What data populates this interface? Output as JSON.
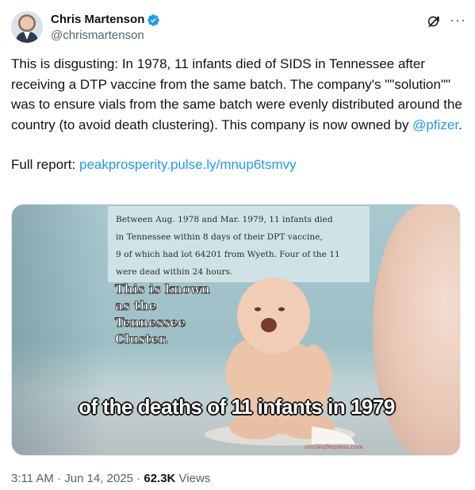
{
  "author": {
    "display_name": "Chris Martenson",
    "handle": "@chrismartenson",
    "verified": true,
    "verified_color": "#1d9bf0"
  },
  "header_icons": [
    "grok-icon",
    "more-icon"
  ],
  "tweet": {
    "text_part1": "This is disgusting: In 1978, 11 infants died of SIDS in Tennessee after receiving a DTP vaccine from the same batch.  The company's \"\"solution\"\" was to ensure vials from the same batch were evenly distributed around the country (to avoid death clustering).  This company is now owned by ",
    "mention": "@pfizer",
    "text_part1_end": ".",
    "full_report_label": "Full report: ",
    "full_report_link": "peakprosperity.pulse.ly/mnup6tsmvy"
  },
  "media": {
    "note_lines": [
      "Between Aug. 1978 and Mar. 1979, 11 infants died",
      "in Tennessee within 8 days of their DPT vaccine,",
      "9 of which had lot 64201 from Wyeth. Four of the 11",
      "were dead within 24 hours."
    ],
    "known_lines": [
      "This is known",
      "as the",
      "Tennessee",
      "Cluster."
    ],
    "caption": "of the deaths of 11 infants in 1979",
    "watermark": "circleofmamas.com"
  },
  "meta": {
    "time": "3:11 AM",
    "separator1": " · ",
    "date": "Jun 14, 2025",
    "separator2": " · ",
    "views_count": "62.3K",
    "views_label": " Views"
  },
  "colors": {
    "link": "#1d9bf0",
    "secondary_text": "#536471",
    "primary_text": "#0f1419"
  }
}
